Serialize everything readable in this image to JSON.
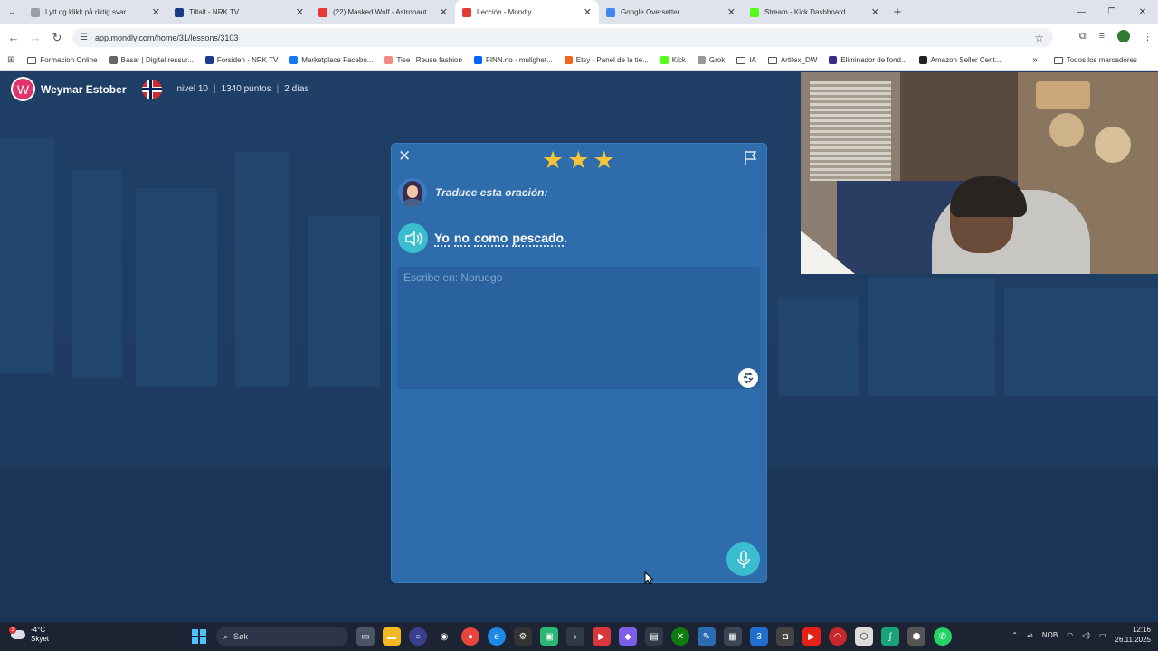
{
  "browser": {
    "tabs": [
      {
        "title": "Lytt og klikk på riktig svar",
        "color": "#9aa0a6",
        "active": false
      },
      {
        "title": "Tiltalt - NRK TV",
        "color": "#1b3a8a",
        "active": false
      },
      {
        "title": "(22) Masked Wolf - Astronaut I...",
        "color": "#e53935",
        "active": false
      },
      {
        "title": "Lección - Mondly",
        "color": "#e53935",
        "active": true
      },
      {
        "title": "Google Oversetter",
        "color": "#4285f4",
        "active": false
      },
      {
        "title": "Stream - Kick Dashboard",
        "color": "#53fc18",
        "active": false
      }
    ],
    "url": "app.mondly.com/home/31/lessons/3103",
    "bookmarks": [
      {
        "label": "Formacion Online",
        "type": "folder",
        "color": "#555"
      },
      {
        "label": "Basar | Digital ressur...",
        "type": "site",
        "color": "#666"
      },
      {
        "label": "Forsiden - NRK TV",
        "type": "site",
        "color": "#1b3a8a"
      },
      {
        "label": "Marketplace Facebo...",
        "type": "site",
        "color": "#1877f2"
      },
      {
        "label": "Tise | Reuse fashion",
        "type": "site",
        "color": "#f28b82"
      },
      {
        "label": "FINN.no - mulighet...",
        "type": "site",
        "color": "#0063fb"
      },
      {
        "label": "Etsy - Panel de la tie...",
        "type": "site",
        "color": "#f1641e"
      },
      {
        "label": "Kick",
        "type": "site",
        "color": "#53fc18"
      },
      {
        "label": "Grok",
        "type": "site",
        "color": "#999"
      },
      {
        "label": "IA",
        "type": "folder",
        "color": "#555"
      },
      {
        "label": "Artifex_DW",
        "type": "folder",
        "color": "#555"
      },
      {
        "label": "Eliminador de fond...",
        "type": "site",
        "color": "#3b2a8a"
      },
      {
        "label": "Amazon Seller Cent...",
        "type": "site",
        "color": "#222"
      }
    ],
    "all_bookmarks": "Todos los marcadores"
  },
  "user": {
    "initial": "W",
    "name": "Weymar Estober",
    "level": "nivel 10",
    "points": "1340 puntos",
    "streak": "2 días"
  },
  "lesson": {
    "stars": 3,
    "instruction": "Traduce esta oración:",
    "sentence_words": [
      "Yo",
      "no",
      "como",
      "pescado"
    ],
    "sentence_end": ".",
    "answer_value": "",
    "answer_placeholder": "Escribe en: Noruego"
  },
  "taskbar": {
    "temperature": "-4°C",
    "weather": "Skyet",
    "weather_badge": "1",
    "search_placeholder": "Søk",
    "language": "NOB",
    "time": "12:16",
    "date": "26.11.2025"
  },
  "colors": {
    "accent": "#3bbdd0",
    "card": "#2f6cab",
    "star": "#f6c439",
    "avatar": "#e2336f"
  }
}
